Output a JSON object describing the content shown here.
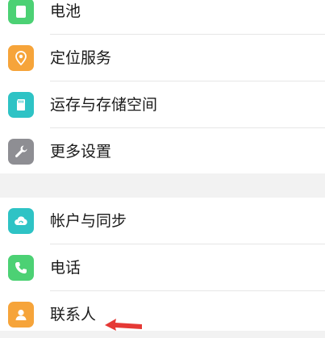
{
  "settings_group_1": {
    "items": [
      {
        "label": "电池",
        "icon": "battery-icon",
        "color": "#4cd174"
      },
      {
        "label": "定位服务",
        "icon": "location-icon",
        "color": "#f6a43a"
      },
      {
        "label": "运存与存储空间",
        "icon": "storage-icon",
        "color": "#2ec3c5"
      },
      {
        "label": "更多设置",
        "icon": "wrench-icon",
        "color": "#8e8e93"
      }
    ]
  },
  "settings_group_2": {
    "items": [
      {
        "label": "帐户与同步",
        "icon": "cloud-sync-icon",
        "color": "#2ec3c5"
      },
      {
        "label": "电话",
        "icon": "phone-icon",
        "color": "#4cd174"
      },
      {
        "label": "联系人",
        "icon": "contacts-icon",
        "color": "#f6a43a"
      }
    ]
  },
  "annotation": {
    "color": "#e53935"
  }
}
